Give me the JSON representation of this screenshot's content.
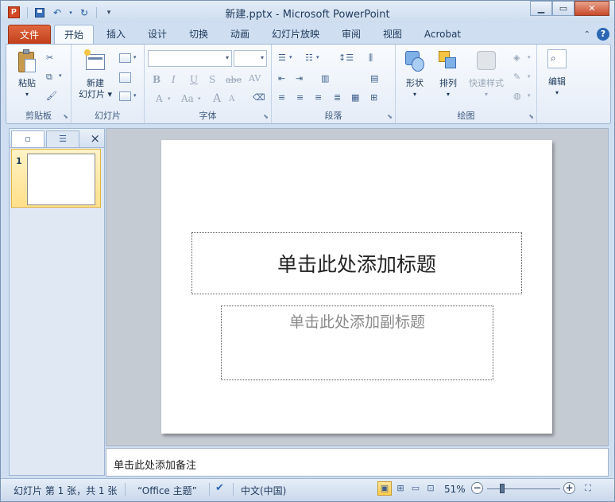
{
  "window": {
    "title": "新建.pptx - Microsoft PowerPoint",
    "app_icon_letter": "P"
  },
  "quick_access": [
    "save-icon",
    "undo-icon",
    "redo-icon",
    "customize-icon"
  ],
  "tabs": {
    "file": "文件",
    "items": [
      "开始",
      "插入",
      "设计",
      "切换",
      "动画",
      "幻灯片放映",
      "审阅",
      "视图",
      "Acrobat"
    ],
    "active": "开始"
  },
  "ribbon": {
    "clipboard": {
      "label": "剪贴板",
      "paste": "粘贴"
    },
    "slides": {
      "label": "幻灯片",
      "new_slide_line1": "新建",
      "new_slide_line2": "幻灯片"
    },
    "font": {
      "label": "字体",
      "font_name": "",
      "font_size": "",
      "bold": "B",
      "italic": "I",
      "underline": "U",
      "shadow": "S",
      "strike": "abe",
      "spacing": "AV",
      "font_color": "A",
      "change_case": "Aa",
      "grow": "A",
      "shrink": "A"
    },
    "paragraph": {
      "label": "段落"
    },
    "drawing": {
      "label": "绘图",
      "shapes": "形状",
      "arrange": "排列",
      "quick_styles": "快速样式"
    },
    "editing": {
      "label": "编辑"
    }
  },
  "slide_pane": {
    "tabs": [
      "slides-tab-icon",
      "outline-tab-icon"
    ],
    "close_label": "×",
    "thumbnail_number": "1"
  },
  "slide": {
    "title_placeholder": "单击此处添加标题",
    "subtitle_placeholder": "单击此处添加副标题"
  },
  "notes": {
    "placeholder": "单击此处添加备注"
  },
  "status": {
    "slide_info": "幻灯片 第 1 张，共 1 张",
    "theme": "“Office 主题”",
    "language": "中文(中国)",
    "zoom": "51%",
    "zoom_minus": "−",
    "zoom_plus": "+"
  },
  "colors": {
    "file_tab": "#c94a22",
    "ribbon_bg": "#e4ecf7",
    "accent": "#2b66b3",
    "active_view": "#ffcd4a"
  }
}
